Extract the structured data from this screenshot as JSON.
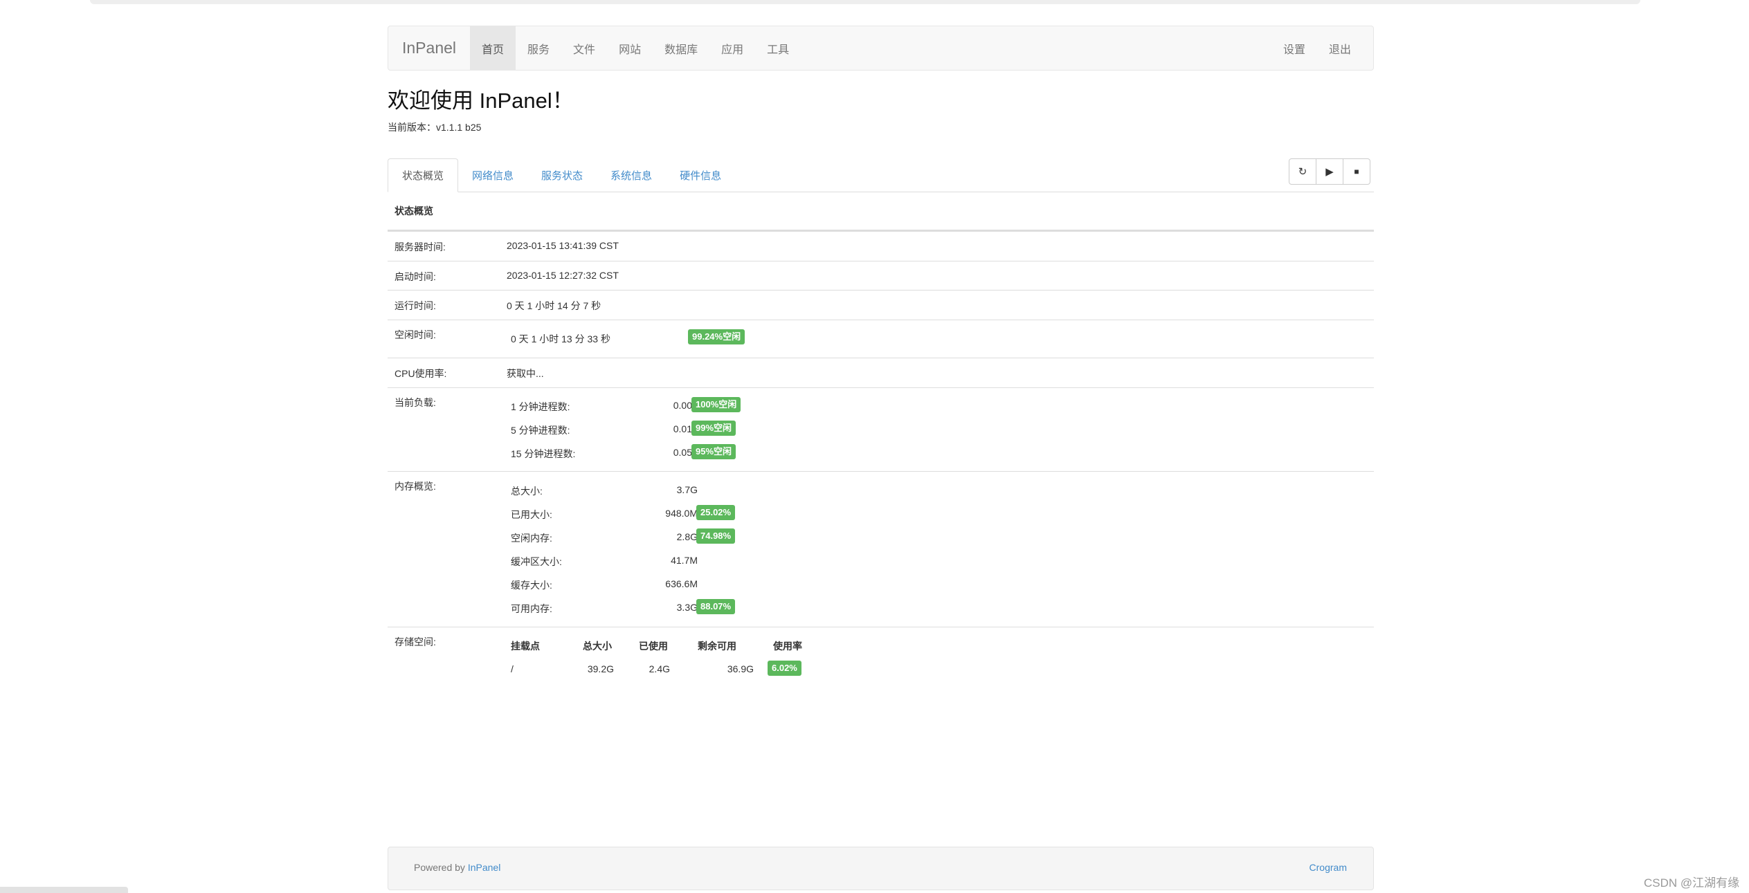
{
  "navbar": {
    "brand": "InPanel",
    "items": [
      {
        "label": "首页",
        "active": true
      },
      {
        "label": "服务"
      },
      {
        "label": "文件"
      },
      {
        "label": "网站"
      },
      {
        "label": "数据库"
      },
      {
        "label": "应用"
      },
      {
        "label": "工具"
      }
    ],
    "right": [
      "设置",
      "退出"
    ]
  },
  "header": {
    "title": "欢迎使用 InPanel！",
    "version": "当前版本：v1.1.1 b25"
  },
  "tabs": [
    "状态概览",
    "网络信息",
    "服务状态",
    "系统信息",
    "硬件信息"
  ],
  "toolbar": {
    "refresh_icon": "refresh-icon",
    "play_icon": "play-icon",
    "stop_icon": "stop-icon"
  },
  "status": {
    "heading": "状态概览",
    "server_time_label": "服务器时间:",
    "server_time": "2023-01-15 13:41:39 CST",
    "boot_time_label": "启动时间:",
    "boot_time": "2023-01-15 12:27:32 CST",
    "uptime_label": "运行时间:",
    "uptime": "0 天 1 小时 14 分 7 秒",
    "idle_label": "空闲时间:",
    "idle": "0 天 1 小时 13 分 33 秒",
    "idle_badge": "99.24%空闲",
    "cpu_label": "CPU使用率:",
    "cpu": "获取中...",
    "load_label": "当前负载:",
    "load": [
      {
        "label": "1 分钟进程数:",
        "value": "0.00",
        "badge": "100%空闲"
      },
      {
        "label": "5 分钟进程数:",
        "value": "0.01",
        "badge": "99%空闲"
      },
      {
        "label": "15 分钟进程数:",
        "value": "0.05",
        "badge": "95%空闲"
      }
    ],
    "mem_label": "内存概览:",
    "mem": [
      {
        "label": "总大小:",
        "value": "3.7G",
        "badge": ""
      },
      {
        "label": "已用大小:",
        "value": "948.0M",
        "badge": "25.02%"
      },
      {
        "label": "空闲内存:",
        "value": "2.8G",
        "badge": "74.98%"
      },
      {
        "label": "缓冲区大小:",
        "value": "41.7M",
        "badge": ""
      },
      {
        "label": "缓存大小:",
        "value": "636.6M",
        "badge": ""
      },
      {
        "label": "可用内存:",
        "value": "3.3G",
        "badge": "88.07%"
      }
    ],
    "storage_label": "存储空间:",
    "storage_headers": [
      "挂载点",
      "总大小",
      "已使用",
      "剩余可用",
      "使用率"
    ],
    "storage_rows": [
      {
        "mount": "/",
        "total": "39.2G",
        "used": "2.4G",
        "free": "36.9G",
        "usage": "6.02%"
      }
    ]
  },
  "footer": {
    "powered_prefix": "Powered by",
    "powered_link": "InPanel",
    "right_link": "Crogram"
  },
  "watermark": "CSDN @江湖有缘"
}
